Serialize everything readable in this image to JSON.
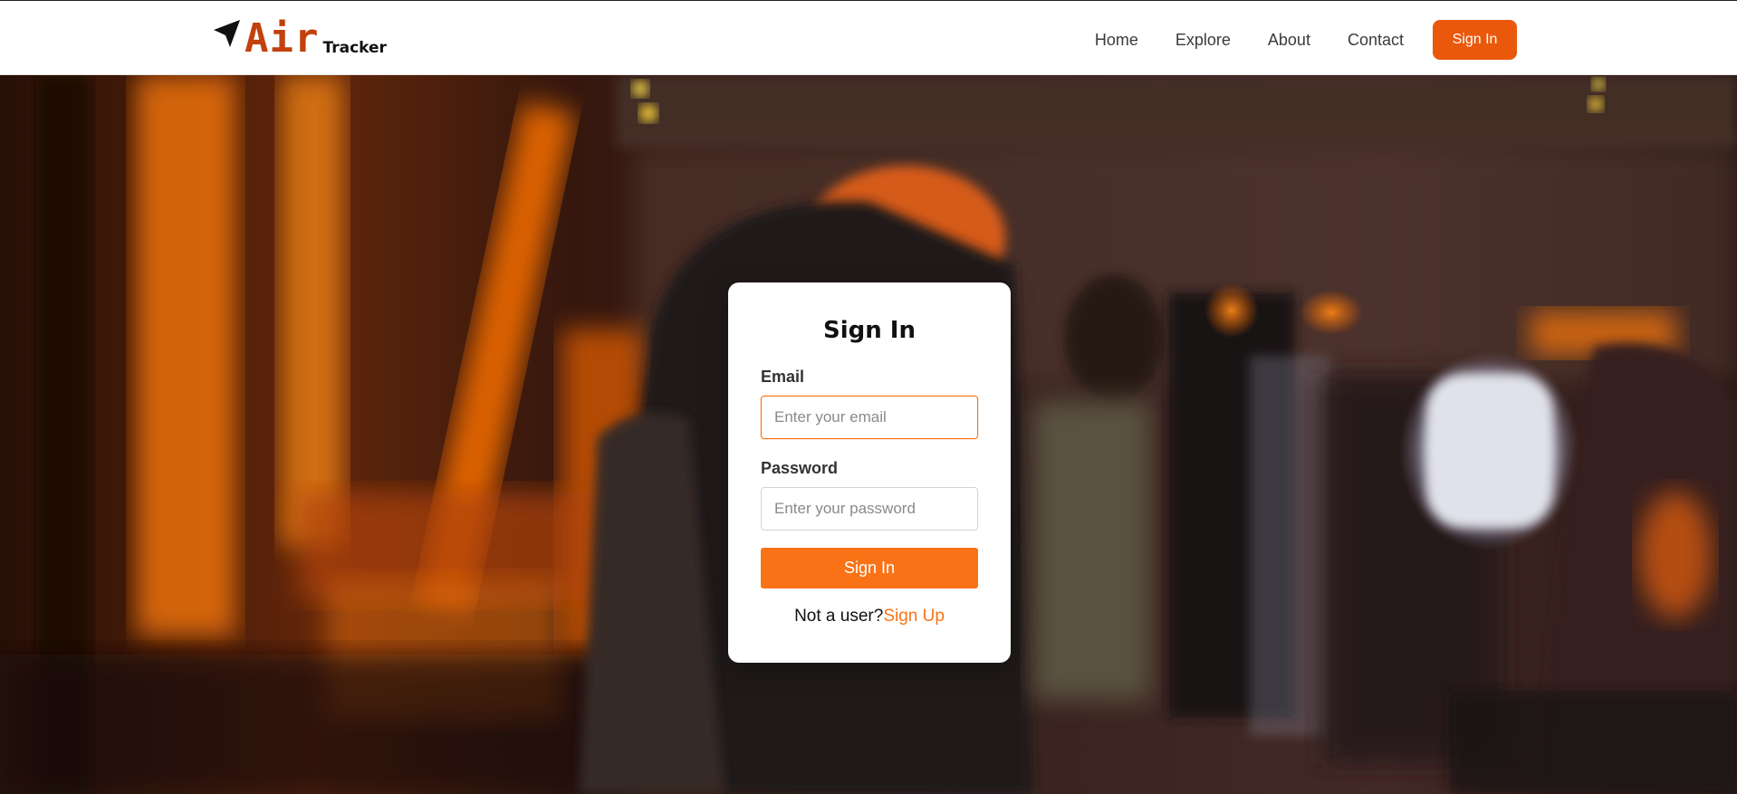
{
  "header": {
    "logo": {
      "brand": "Air",
      "suffix": "Tracker",
      "icon": "paper-plane-icon"
    },
    "nav": [
      {
        "label": "Home"
      },
      {
        "label": "Explore"
      },
      {
        "label": "About"
      },
      {
        "label": "Contact"
      }
    ],
    "signin_button": "Sign In"
  },
  "hero": {
    "background_image": "airplane-cabin-orange-light"
  },
  "signin_card": {
    "title": "Sign In",
    "email": {
      "label": "Email",
      "placeholder": "Enter your email",
      "value": ""
    },
    "password": {
      "label": "Password",
      "placeholder": "Enter your password",
      "value": ""
    },
    "submit_label": "Sign In",
    "signup_prompt": "Not a user?",
    "signup_link": "Sign Up"
  },
  "colors": {
    "brand_orange": "#ea580c",
    "accent_orange": "#f97316",
    "logo_orange": "#c2410c"
  }
}
